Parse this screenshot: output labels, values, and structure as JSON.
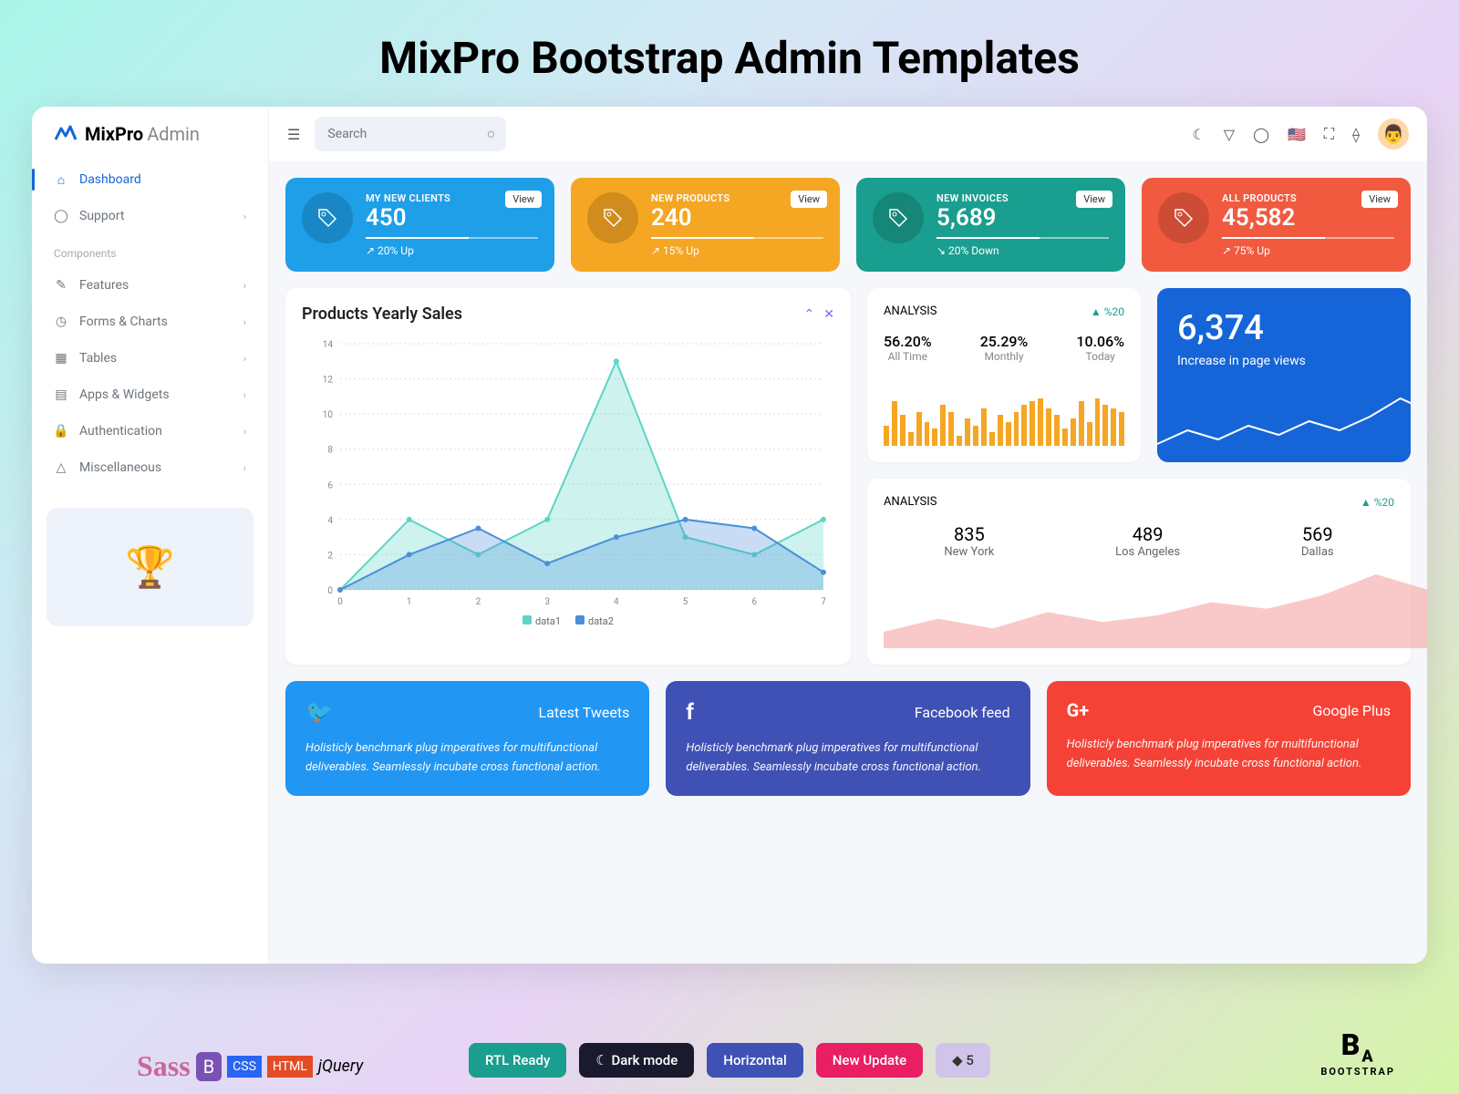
{
  "page_title": "MixPro Bootstrap Admin Templates",
  "brand": {
    "name": "MixPro",
    "suffix": "Admin"
  },
  "search": {
    "placeholder": "Search"
  },
  "nav": {
    "dashboard": "Dashboard",
    "support": "Support",
    "section": "Components",
    "features": "Features",
    "forms": "Forms & Charts",
    "tables": "Tables",
    "apps": "Apps & Widgets",
    "auth": "Authentication",
    "misc": "Miscellaneous"
  },
  "kpi": [
    {
      "label": "MY NEW CLIENTS",
      "value": "450",
      "trend": "20% Up",
      "view": "View"
    },
    {
      "label": "NEW PRODUCTS",
      "value": "240",
      "trend": "15% Up",
      "view": "View"
    },
    {
      "label": "NEW INVOICES",
      "value": "5,689",
      "trend": "20% Down",
      "view": "View"
    },
    {
      "label": "ALL PRODUCTS",
      "value": "45,582",
      "trend": "75% Up",
      "view": "View"
    }
  ],
  "sales_chart": {
    "title": "Products Yearly Sales",
    "legend1": "data1",
    "legend2": "data2"
  },
  "analysis1": {
    "title": "ANALYSIS",
    "pct": "%20",
    "stats": [
      {
        "v": "56.20%",
        "l": "All Time"
      },
      {
        "v": "25.29%",
        "l": "Monthly"
      },
      {
        "v": "10.06%",
        "l": "Today"
      }
    ]
  },
  "big_stat": {
    "value": "6,374",
    "label": "Increase in page views"
  },
  "analysis2": {
    "title": "ANALYSIS",
    "pct": "%20",
    "cities": [
      {
        "v": "835",
        "l": "New York"
      },
      {
        "v": "489",
        "l": "Los Angeles"
      },
      {
        "v": "569",
        "l": "Dallas"
      }
    ]
  },
  "social": [
    {
      "title": "Latest Tweets",
      "body": "Holisticly benchmark plug imperatives for multifunctional deliverables. Seamlessly incubate cross functional action."
    },
    {
      "title": "Facebook feed",
      "body": "Holisticly benchmark plug imperatives for multifunctional deliverables. Seamlessly incubate cross functional action."
    },
    {
      "title": "Google Plus",
      "body": "Holisticly benchmark plug imperatives for multifunctional deliverables. Seamlessly incubate cross functional action."
    }
  ],
  "footer": {
    "rtl": "RTL Ready",
    "dark": "Dark mode",
    "horiz": "Horizontal",
    "update": "New Update",
    "bs": "5",
    "boot": "BOOTSTRAP"
  },
  "chart_data": [
    {
      "type": "area",
      "title": "Products Yearly Sales",
      "x": [
        0,
        1,
        2,
        3,
        4,
        5,
        6,
        7
      ],
      "ylim": [
        0,
        14
      ],
      "series": [
        {
          "name": "data1",
          "values": [
            0,
            4,
            2,
            4,
            13,
            3,
            2,
            4
          ],
          "color": "#5ed4c7"
        },
        {
          "name": "data2",
          "values": [
            0,
            2,
            3.5,
            1.5,
            3,
            4,
            3.5,
            1
          ],
          "color": "#4a90d9"
        }
      ]
    },
    {
      "type": "bar",
      "title": "ANALYSIS bars",
      "categories": [
        1,
        2,
        3,
        4,
        5,
        6,
        7,
        8,
        9,
        10,
        11,
        12,
        13,
        14,
        15,
        16,
        17,
        18,
        19,
        20,
        21,
        22,
        23,
        24,
        25,
        26,
        27,
        28,
        29,
        30
      ],
      "values": [
        30,
        65,
        45,
        20,
        50,
        35,
        25,
        60,
        50,
        15,
        40,
        30,
        55,
        20,
        45,
        35,
        50,
        60,
        65,
        70,
        55,
        45,
        25,
        40,
        65,
        35,
        70,
        60,
        55,
        50
      ],
      "color": "#f5a623"
    },
    {
      "type": "line",
      "title": "Page views sparkline",
      "x": [
        0,
        1,
        2,
        3,
        4,
        5,
        6,
        7,
        8,
        9
      ],
      "values": [
        20,
        35,
        25,
        40,
        30,
        45,
        35,
        50,
        70,
        55
      ],
      "color": "#fff"
    },
    {
      "type": "area",
      "title": "Cities area",
      "x": [
        0,
        1,
        2,
        3,
        4,
        5,
        6,
        7,
        8,
        9,
        10
      ],
      "values": [
        10,
        18,
        12,
        22,
        16,
        20,
        28,
        24,
        32,
        45,
        35
      ],
      "color": "#f5a3a3"
    }
  ]
}
